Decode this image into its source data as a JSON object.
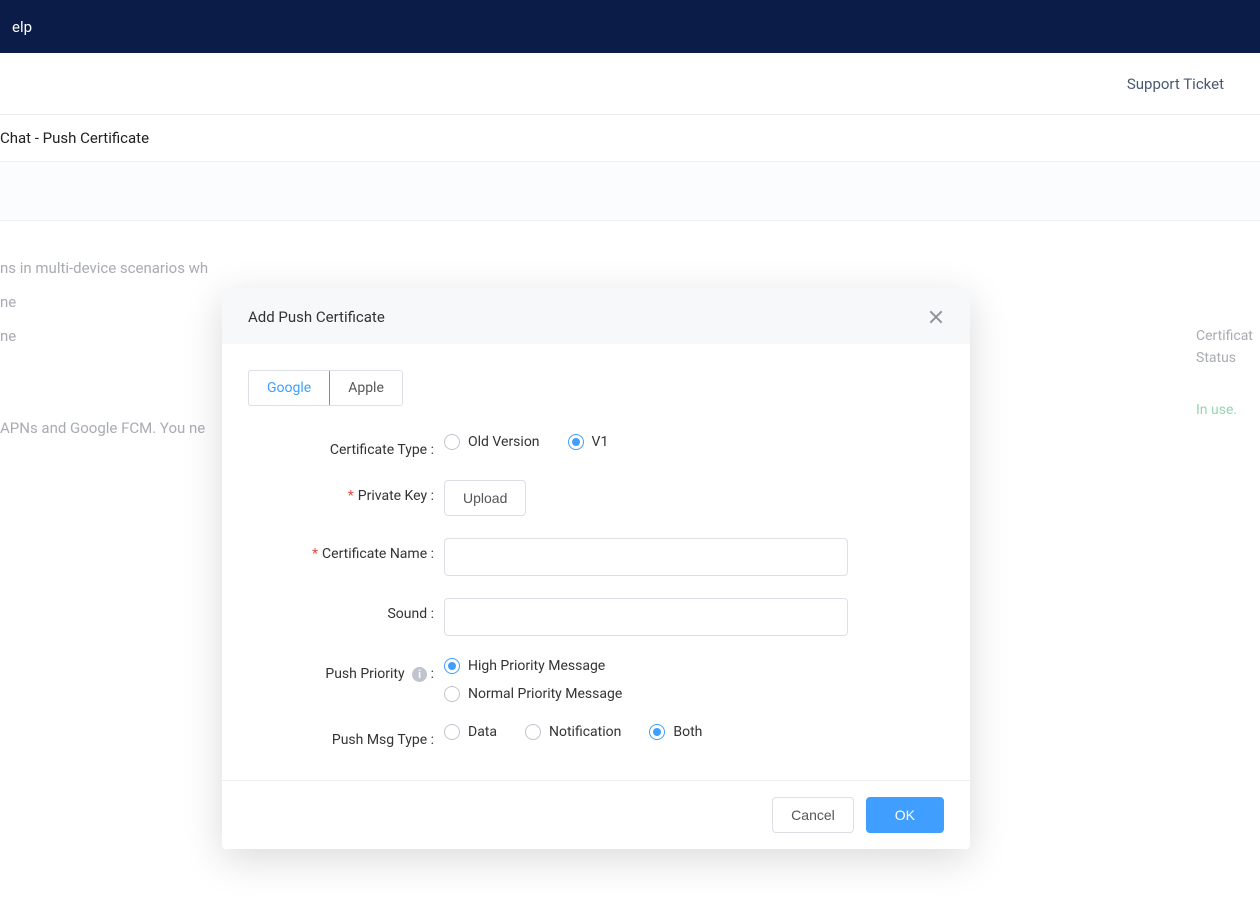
{
  "topbar": {
    "help_fragment": "elp"
  },
  "subbar": {
    "support_ticket": "Support Ticket"
  },
  "page": {
    "title": "Chat - Push Certificate"
  },
  "background": {
    "line1": "ns in multi-device scenarios wh",
    "line2": "ne",
    "line3": "ne",
    "info_line": "APNs and Google FCM. You ne"
  },
  "right_column": {
    "cert_label_part": "Certificat",
    "status_label": "Status",
    "in_use": "In use."
  },
  "modal": {
    "title": "Add Push Certificate",
    "tabs": {
      "google": "Google",
      "apple": "Apple"
    },
    "labels": {
      "certificate_type": "Certificate Type",
      "private_key": "Private Key",
      "certificate_name": "Certificate Name",
      "sound": "Sound",
      "push_priority": "Push Priority",
      "push_msg_type": "Push Msg Type"
    },
    "options": {
      "old_version": "Old Version",
      "v1": "V1",
      "high_priority": "High Priority Message",
      "normal_priority": "Normal Priority Message",
      "data": "Data",
      "notification": "Notification",
      "both": "Both"
    },
    "buttons": {
      "upload": "Upload",
      "cancel": "Cancel",
      "ok": "OK"
    },
    "values": {
      "certificate_name": "",
      "sound": ""
    }
  }
}
